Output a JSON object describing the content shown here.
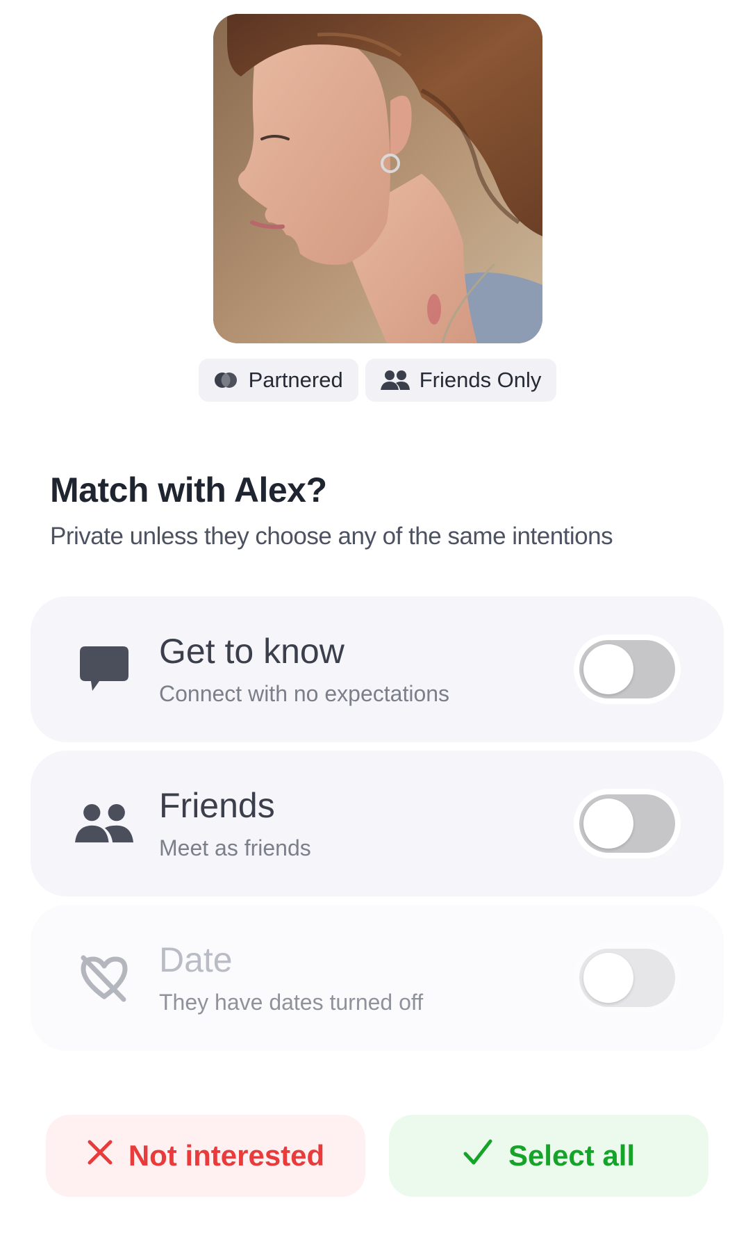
{
  "profile": {
    "photo_alt": "profile-photo"
  },
  "chips": [
    {
      "label": "Partnered",
      "icon": "partnered-icon"
    },
    {
      "label": "Friends Only",
      "icon": "people-icon"
    }
  ],
  "prompt": {
    "title": "Match with Alex?",
    "subtitle": "Private unless they choose any of the same intentions"
  },
  "intentions": [
    {
      "title": "Get to know",
      "subtitle": "Connect with no expectations",
      "icon": "chat-bubble-icon",
      "enabled": false,
      "disabled": false
    },
    {
      "title": "Friends",
      "subtitle": "Meet as friends",
      "icon": "people-icon",
      "enabled": false,
      "disabled": false
    },
    {
      "title": "Date",
      "subtitle": "They have dates turned off",
      "icon": "heart-off-icon",
      "enabled": false,
      "disabled": true
    }
  ],
  "actions": {
    "not_interested_label": "Not interested",
    "select_all_label": "Select all"
  },
  "colors": {
    "decline": "#e83b3b",
    "accept": "#16a32a",
    "card_bg": "#f5f5fa",
    "chip_bg": "#f1f1f6"
  }
}
